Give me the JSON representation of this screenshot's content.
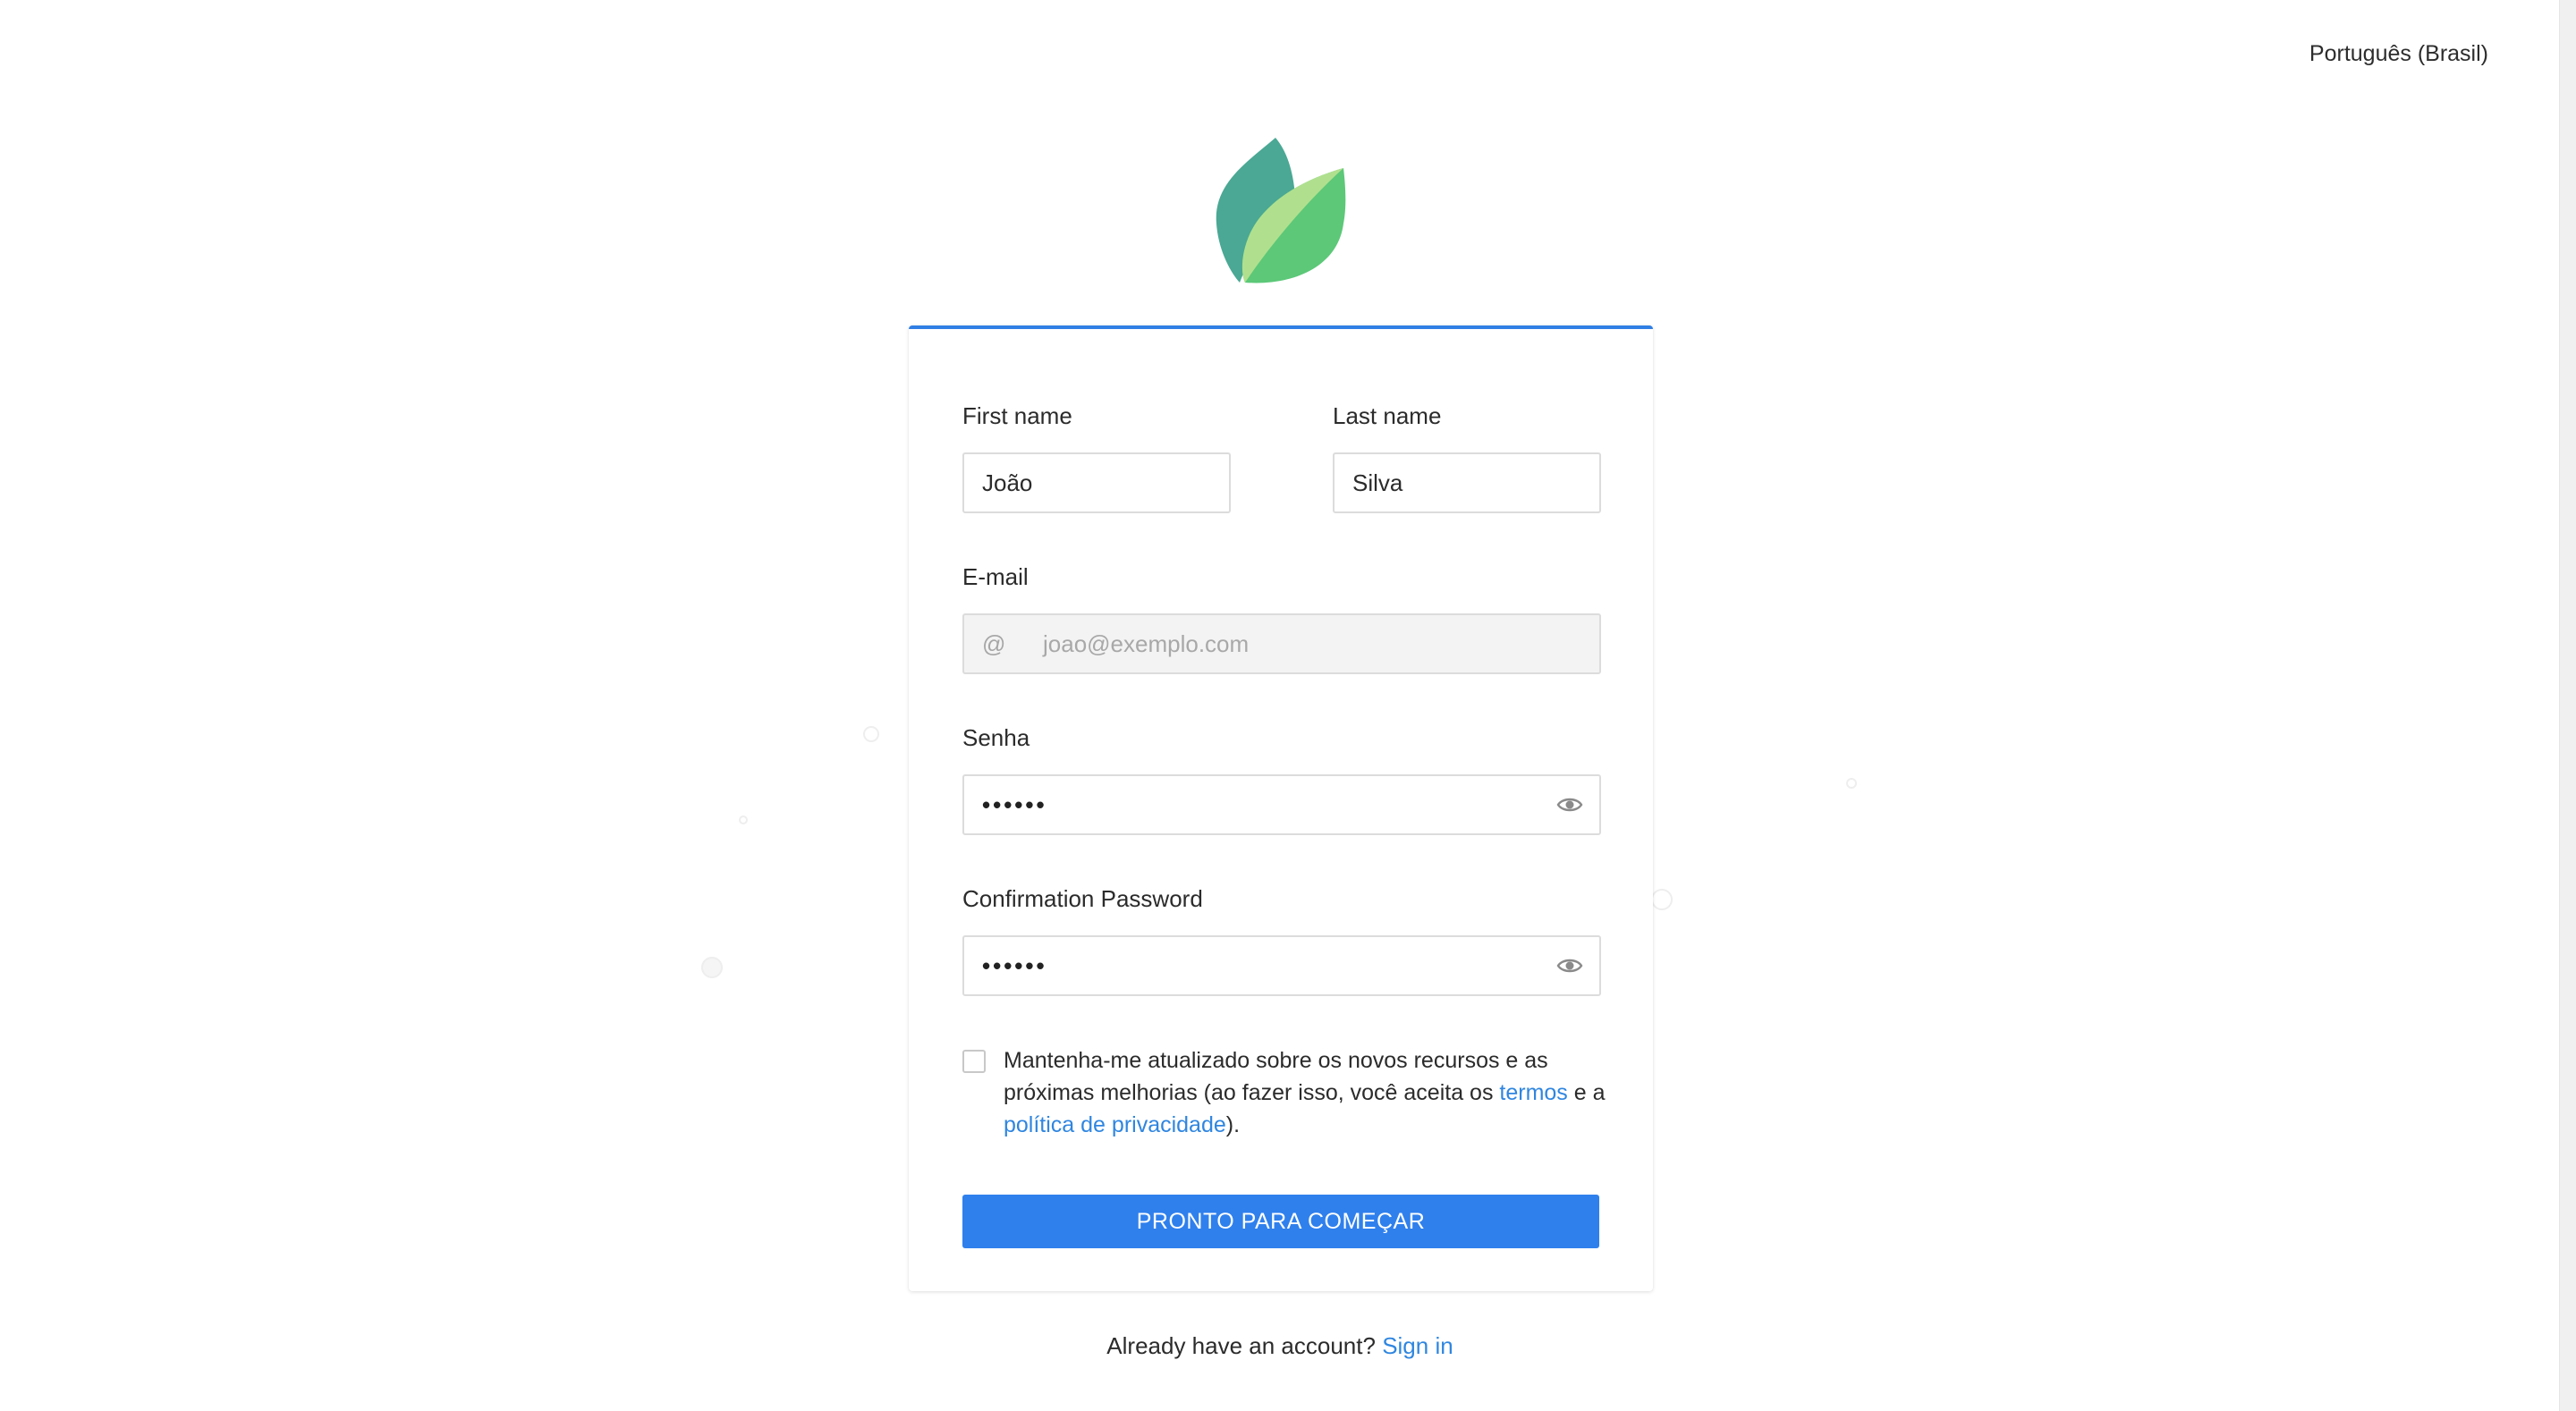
{
  "language_selector": {
    "label": "Português (Brasil)"
  },
  "form": {
    "first_name": {
      "label": "First name",
      "value": "João"
    },
    "last_name": {
      "label": "Last name",
      "value": "Silva"
    },
    "email": {
      "label": "E-mail",
      "prefix": "@",
      "placeholder": "joao@exemplo.com"
    },
    "password": {
      "label": "Senha",
      "masked_value": "••••••"
    },
    "confirm_password": {
      "label": "Confirmation Password",
      "masked_value": "••••••"
    },
    "consent": {
      "checked": false,
      "text_before": "Mantenha-me atualizado sobre os novos recursos e as próximas melhorias (ao fazer isso, você aceita os ",
      "terms_link": "termos",
      "text_middle": " e a ",
      "privacy_link": "política de privacidade",
      "text_after": ")."
    },
    "submit_label": "PRONTO PARA COMEÇAR"
  },
  "footer": {
    "prompt": "Already have an account?",
    "signin_link": "Sign in"
  },
  "colors": {
    "accent": "#2f80ed",
    "link": "#2f86e0",
    "logo_dark_leaf": "#4aa894",
    "logo_light_leaf": "#b0e08e",
    "logo_mid_leaf": "#5cc878"
  },
  "icons": [
    "leaf-logo-icon",
    "at-sign-icon",
    "eye-icon"
  ]
}
